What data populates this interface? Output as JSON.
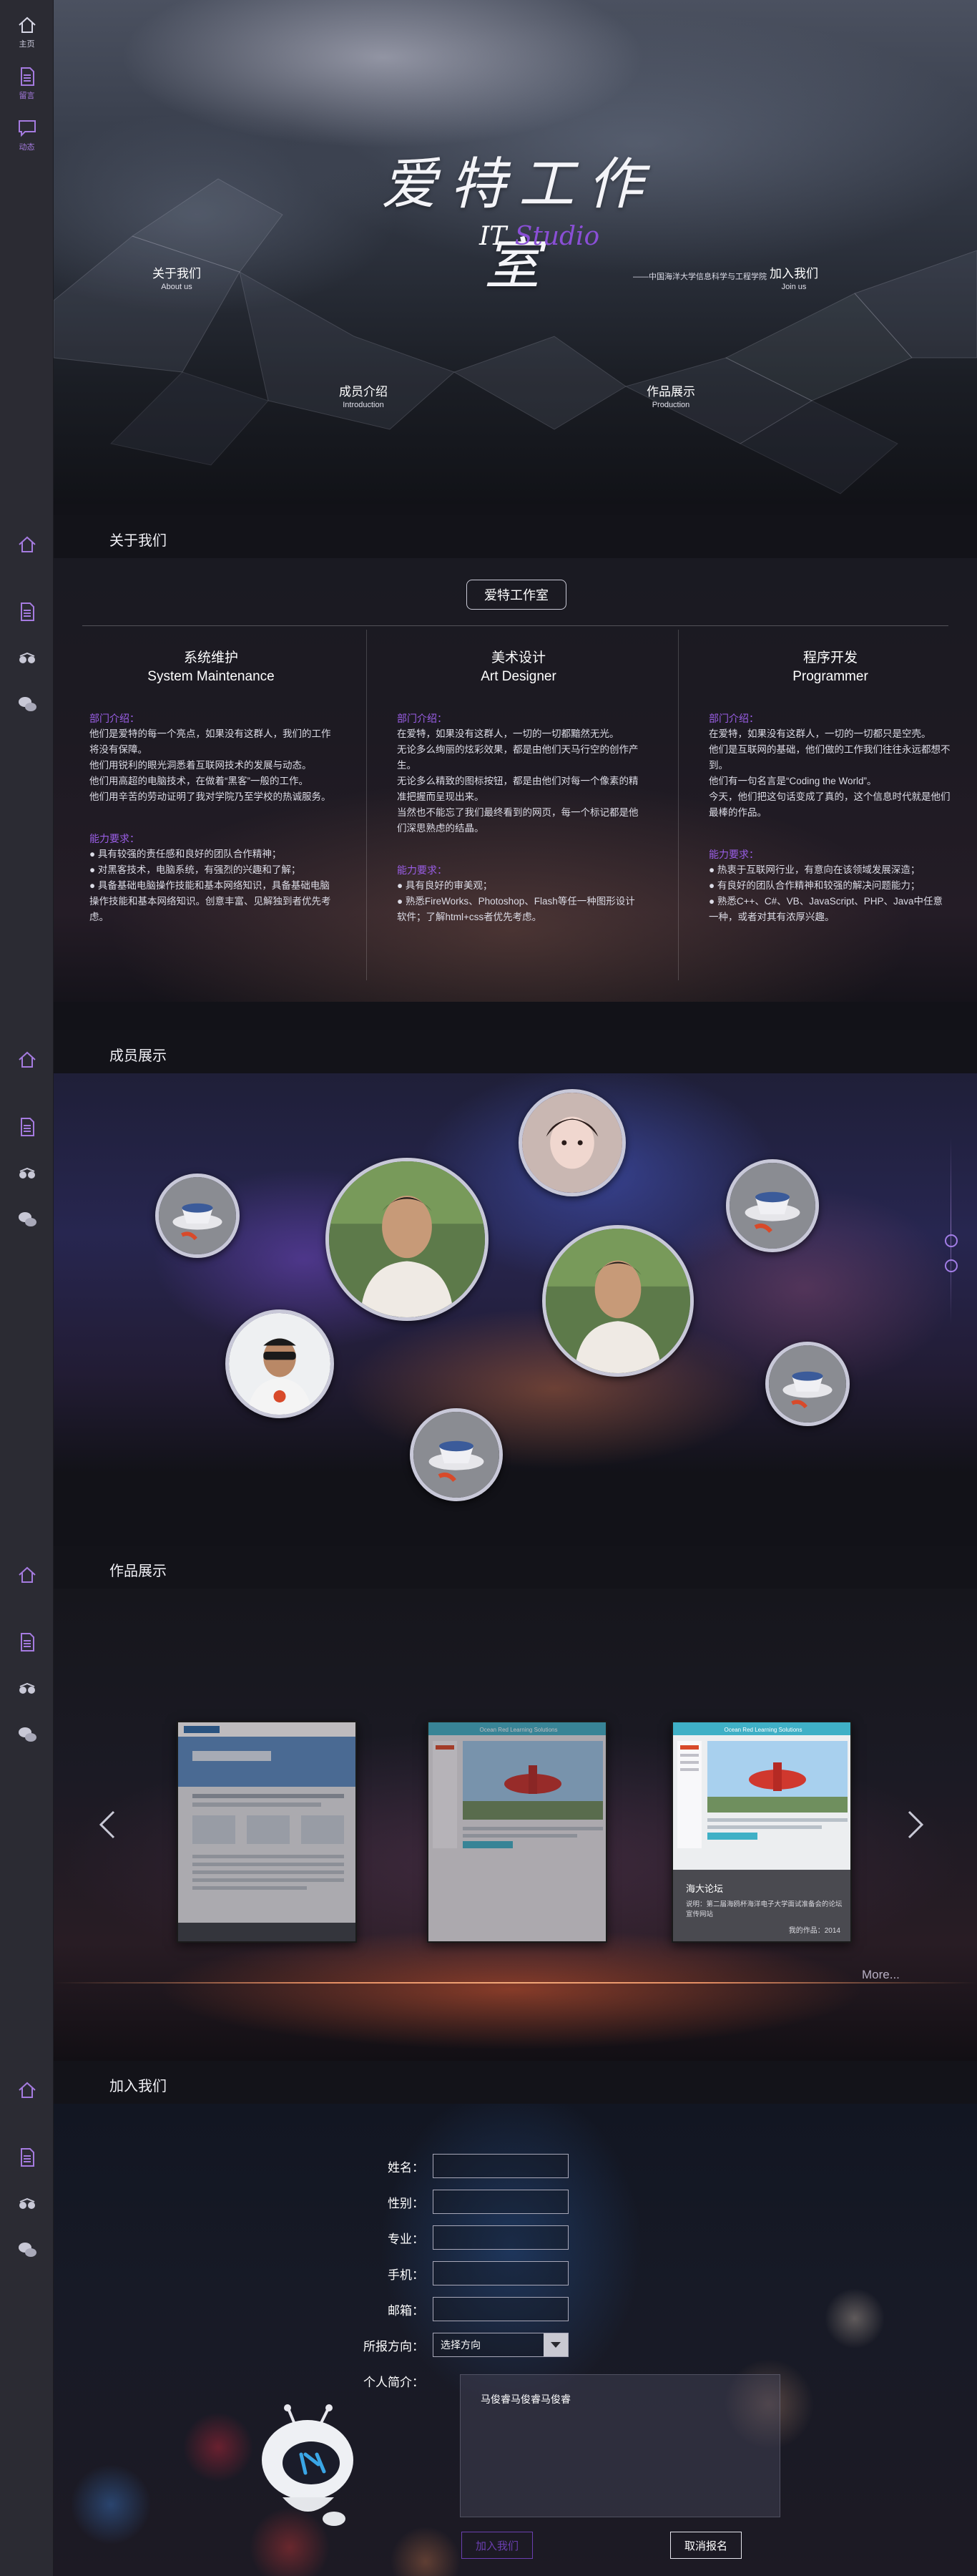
{
  "sidebar": {
    "top": [
      {
        "label": "主页",
        "icon": "home-icon"
      },
      {
        "label": "留言",
        "icon": "document-icon"
      },
      {
        "label": "动态",
        "icon": "chat-icon"
      }
    ]
  },
  "hero": {
    "title": "爱特工作室",
    "subtitle_white": "IT ",
    "subtitle_purple": "Studio",
    "school": "——中国海洋大学信息科学与工程学院",
    "nav": [
      {
        "zh": "关于我们",
        "en": "About us"
      },
      {
        "zh": "加入我们",
        "en": "Join us"
      },
      {
        "zh": "成员介绍",
        "en": "Introduction"
      },
      {
        "zh": "作品展示",
        "en": "Production"
      }
    ]
  },
  "about": {
    "section_title": "关于我们",
    "studio_button": "爱特工作室",
    "columns": [
      {
        "zh": "系统维护",
        "en": "System Maintenance",
        "intro_h": "部门介绍：",
        "intro": [
          "他们是爱特的每一个亮点，如果没有这群人，我们的工作将没有保障。",
          "他们用锐利的眼光洞悉着互联网技术的发展与动态。",
          "他们用高超的电脑技术，在做着“黑客”一般的工作。",
          "他们用辛苦的劳动证明了我对学院乃至学校的热诚服务。"
        ],
        "req_h": "能力要求：",
        "req": [
          "● 具有较强的责任感和良好的团队合作精神；",
          "● 对黑客技术，电脑系统，有强烈的兴趣和了解；",
          "● 具备基础电脑操作技能和基本网络知识，具备基础电脑操作技能和基本网络知识。创意丰富、见解独到者优先考虑。"
        ]
      },
      {
        "zh": "美术设计",
        "en": "Art Designer",
        "intro_h": "部门介绍：",
        "intro": [
          "在爱特，如果没有这群人，一切的一切都黯然无光。",
          "无论多么绚丽的炫彩效果，都是由他们天马行空的创作产生。",
          "无论多么精致的图标按钮，都是由他们对每一个像素的精准把握而呈现出来。",
          "当然也不能忘了我们最终看到的网页，每一个标记都是他们深思熟虑的结晶。"
        ],
        "req_h": "能力要求：",
        "req": [
          "● 具有良好的审美观；",
          "● 熟悉FireWorks、Photoshop、Flash等任一种图形设计软件；了解html+css者优先考虑。"
        ]
      },
      {
        "zh": "程序开发",
        "en": "Programmer",
        "intro_h": "部门介绍：",
        "intro": [
          "在爱特，如果没有这群人，一切的一切都只是空壳。",
          "他们是互联网的基础，他们做的工作我们往往永远都想不到。",
          "他们有一句名言是“Coding the World”。",
          "今天，他们把这句话变成了真的，这个信息时代就是他们最棒的作品。"
        ],
        "req_h": "能力要求：",
        "req": [
          "● 热衷于互联网行业，有意向在该领域发展深造；",
          "● 有良好的团队合作精神和较强的解决问题能力；",
          "● 熟悉C++、C#、VB、JavaScript、PHP、Java中任意一种，或者对其有浓厚兴趣。"
        ]
      }
    ]
  },
  "members": {
    "section_title": "成员展示"
  },
  "works": {
    "section_title": "作品展示",
    "featured_title": "海大论坛",
    "featured_desc": "说明：第二届海鸥杯海洋电子大学面试准备会的论坛宣传网站",
    "featured_meta": "我的作品：2014",
    "more": "More...",
    "thumb_title": "Ocean Red Learning Solutions"
  },
  "join": {
    "section_title": "加入我们",
    "fields": [
      {
        "label": "姓名：",
        "value": ""
      },
      {
        "label": "性别：",
        "value": ""
      },
      {
        "label": "专业：",
        "value": ""
      },
      {
        "label": "手机：",
        "value": ""
      },
      {
        "label": "邮箱：",
        "value": ""
      }
    ],
    "direction_label": "所报方向：",
    "direction_value": "选择方向",
    "intro_label": "个人简介：",
    "intro_value": "马俊睿马俊睿马俊睿",
    "submit": "加入我们",
    "cancel": "取消报名"
  },
  "colors": {
    "accent": "#8a4fd6",
    "sidebar": "#2b2b33"
  }
}
